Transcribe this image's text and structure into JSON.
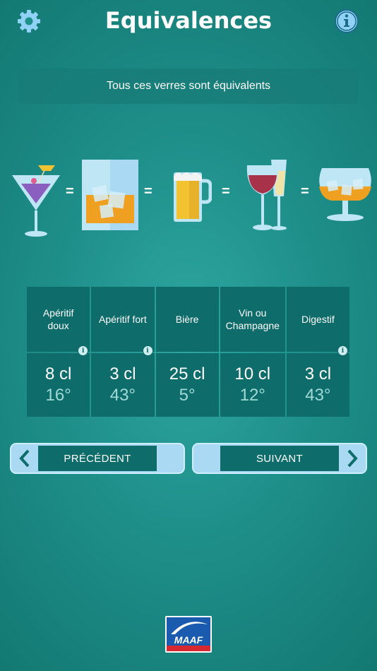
{
  "header": {
    "title": "Equivalences"
  },
  "banner": {
    "text": "Tous ces verres sont équivalents"
  },
  "glasses": {
    "items": [
      "cocktail-glass-icon",
      "whisky-glass-icon",
      "beer-mug-icon",
      "wine-champagne-glasses-icon",
      "brandy-snifter-icon"
    ],
    "separator": "="
  },
  "drinks": [
    {
      "name": "Apéritif doux",
      "volume": "8 cl",
      "degree": "16°"
    },
    {
      "name": "Apéritif fort",
      "volume": "3 cl",
      "degree": "43°"
    },
    {
      "name": "Bière",
      "volume": "25 cl",
      "degree": "5°"
    },
    {
      "name": "Vin ou Champagne",
      "volume": "10 cl",
      "degree": "12°"
    },
    {
      "name": "Digestif",
      "volume": "3 cl",
      "degree": "43°"
    }
  ],
  "info_marker": "i",
  "nav": {
    "prev_label": "PRÉCÉDENT",
    "next_label": "SUIVANT"
  },
  "logo": {
    "text": "MAAF"
  },
  "colors": {
    "background": "#1f8f8a",
    "cell": "#0e6c6a",
    "button": "#a9d9f3",
    "degree_text": "#9fdad7",
    "logo_blue": "#1a5bb0",
    "logo_red": "#d6282f"
  }
}
